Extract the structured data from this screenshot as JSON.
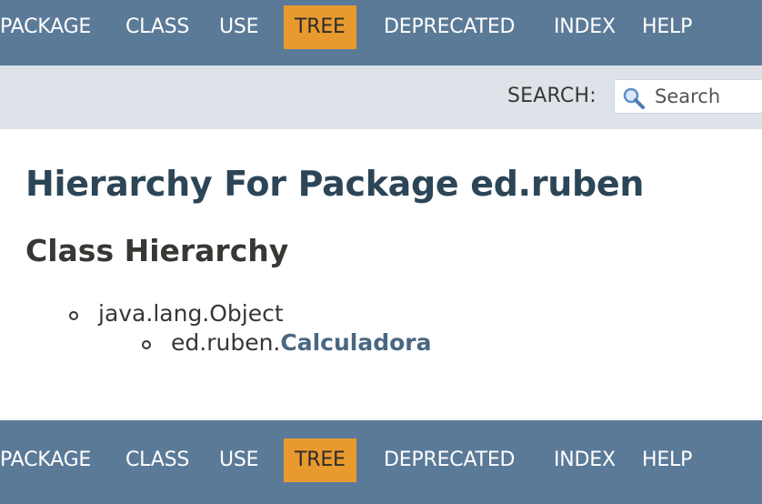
{
  "nav": {
    "items": [
      {
        "label": "PACKAGE",
        "active": false
      },
      {
        "label": "CLASS",
        "active": false
      },
      {
        "label": "USE",
        "active": false
      },
      {
        "label": "TREE",
        "active": true
      },
      {
        "label": "DEPRECATED",
        "active": false
      },
      {
        "label": "INDEX",
        "active": false
      },
      {
        "label": "HELP",
        "active": false
      }
    ]
  },
  "search": {
    "label": "SEARCH:",
    "placeholder": "Search",
    "icon": "magnifier-icon"
  },
  "main": {
    "title": "Hierarchy For Package ed.ruben",
    "section_title": "Class Hierarchy",
    "tree": {
      "root": "java.lang.Object",
      "child_package": "ed.ruben.",
      "child_class": "Calculadora"
    }
  },
  "colors": {
    "navbar": "#5b7a98",
    "active_tab": "#e99a2f",
    "subnav": "#dee3e9",
    "title": "#2c4557",
    "link": "#4a6782"
  }
}
